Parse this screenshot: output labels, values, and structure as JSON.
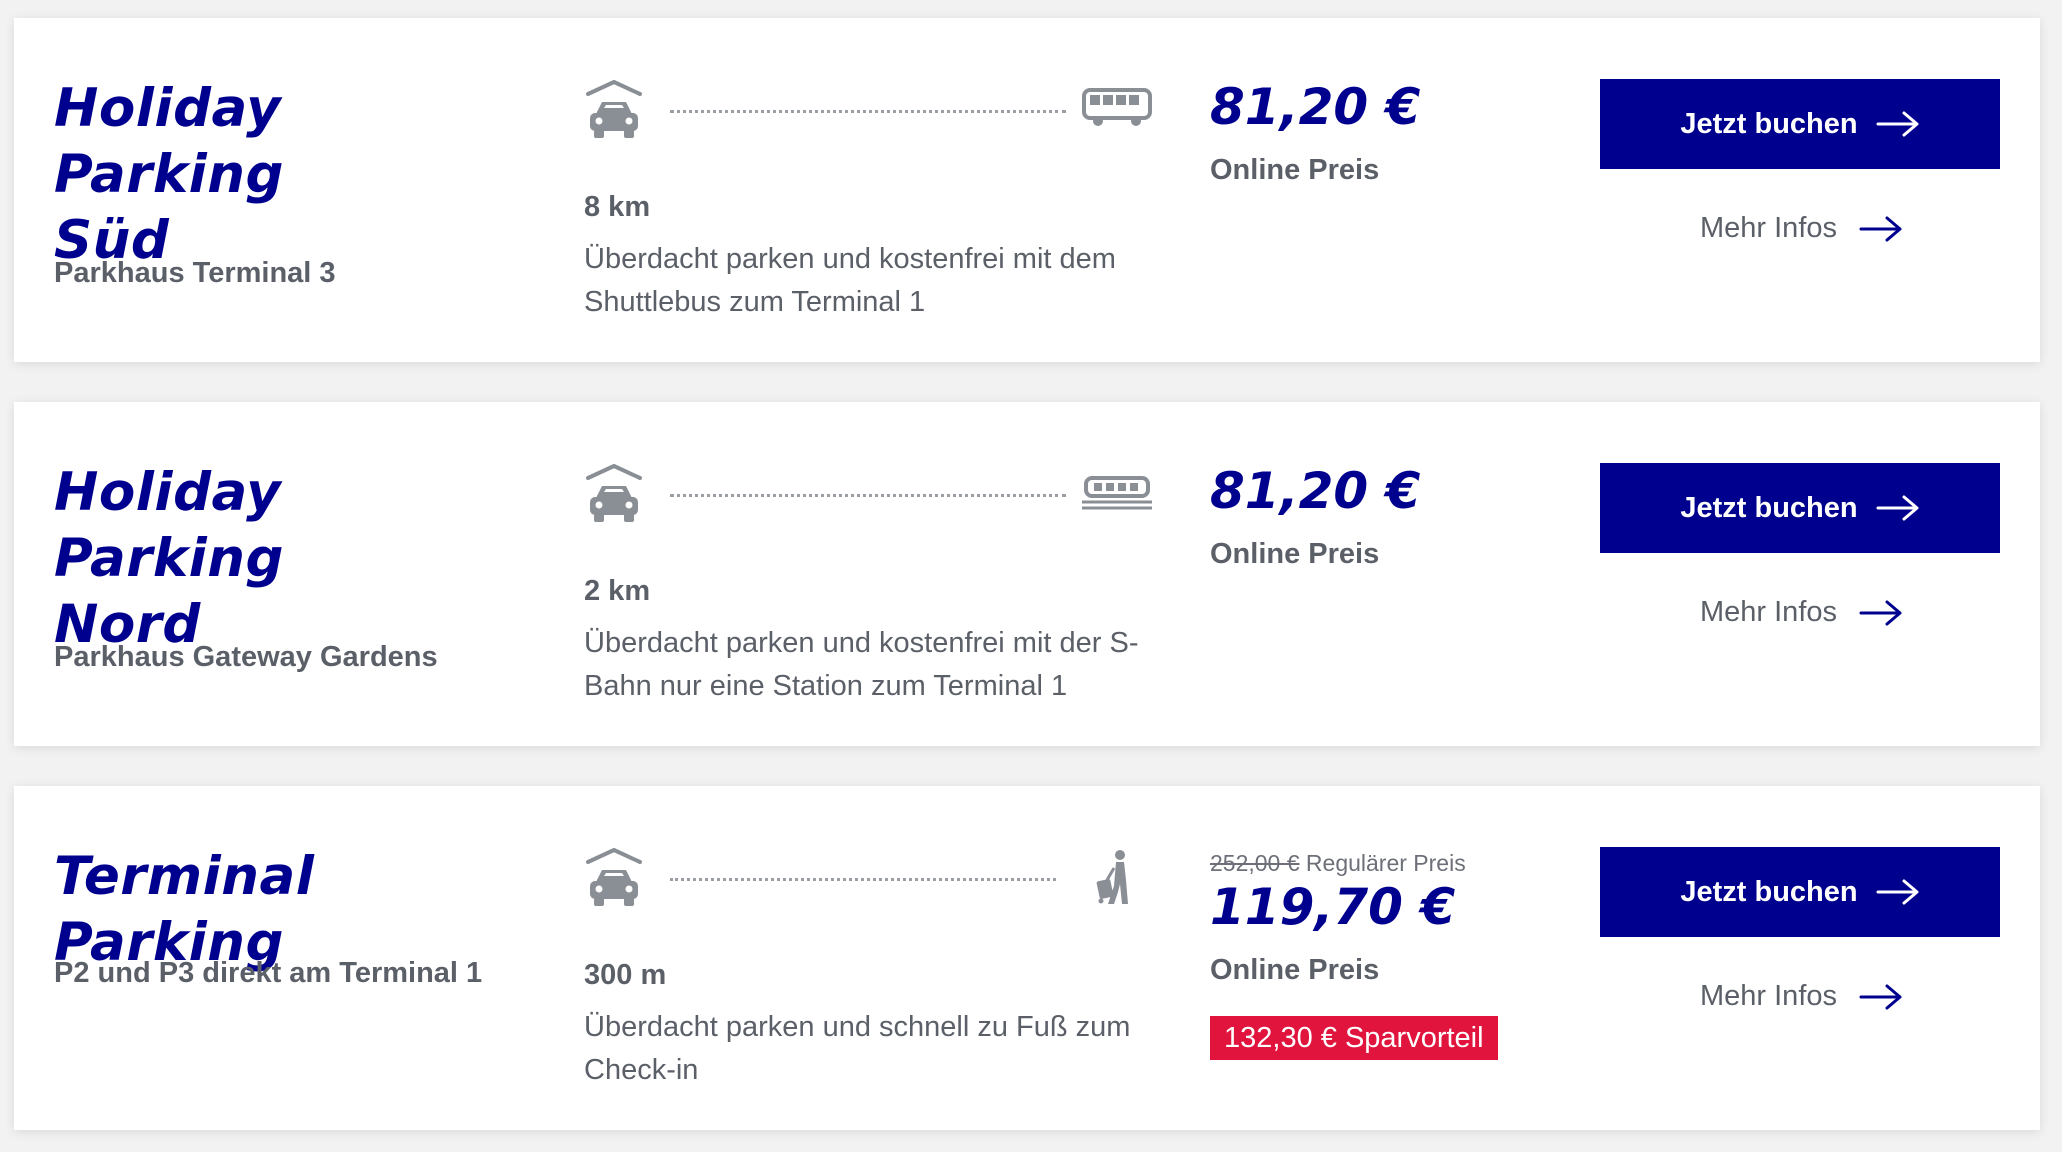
{
  "offers": [
    {
      "name": "Holiday Parking\nSüd",
      "location": "Parkhaus Terminal 3",
      "distance": "8 km",
      "description": "Überdacht parken und kostenfrei mit dem Shuttlebus zum Terminal 1",
      "destination_icon": "bus-icon",
      "price": "81,20 €",
      "price_label": "Online Preis",
      "book_label": "Jetzt buchen",
      "more_label": "Mehr Infos"
    },
    {
      "name": "Holiday Parking\nNord",
      "location": "Parkhaus Gateway Gardens",
      "distance": "2 km",
      "description": "Überdacht parken und kostenfrei mit der S-Bahn nur eine Station zum Terminal 1",
      "destination_icon": "train-icon",
      "price": "81,20 €",
      "price_label": "Online Preis",
      "book_label": "Jetzt buchen",
      "more_label": "Mehr Infos"
    },
    {
      "name": "Terminal Parking",
      "location": "P2 und P3 direkt am Terminal 1",
      "distance": "300 m",
      "description": "Überdacht parken und schnell zu Fuß zum Check-in",
      "destination_icon": "walking-traveler-icon",
      "regular_price": "252,00 €",
      "regular_label": "Regulärer Preis",
      "price": "119,70 €",
      "price_label": "Online Preis",
      "saving": "132,30 € Sparvorteil",
      "book_label": "Jetzt buchen",
      "more_label": "Mehr Infos"
    }
  ],
  "colors": {
    "brand": "#00008f",
    "text": "#5b5f67",
    "saving_bg": "#e0143c",
    "icon": "#8a8e95"
  }
}
